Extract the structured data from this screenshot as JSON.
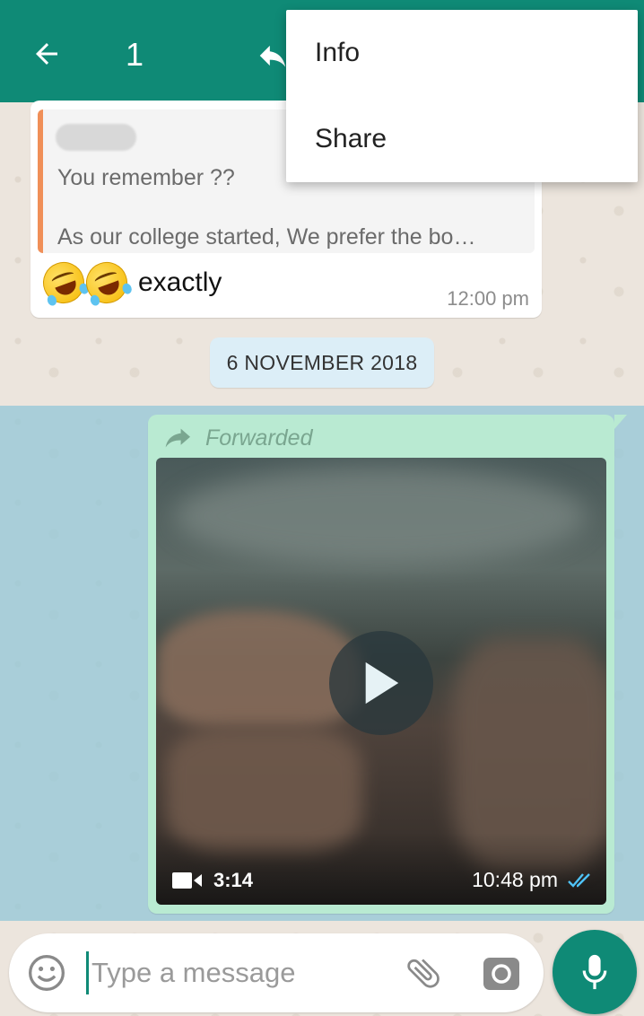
{
  "header": {
    "selected_count": "1",
    "back_icon": "arrow-left-icon",
    "reply_icon": "reply-icon"
  },
  "menu": {
    "items": [
      {
        "label": "Info"
      },
      {
        "label": "Share"
      }
    ]
  },
  "messages": {
    "incoming": {
      "quote": {
        "line1": "You remember ??",
        "line2": "As our college started, We prefer the bo…"
      },
      "emoji": "rolling-on-floor-laughing-emoji",
      "text": "exactly",
      "time": "12:00 pm"
    },
    "date_divider": "6 NOVEMBER 2018",
    "outgoing": {
      "forwarded_label": "Forwarded",
      "video_duration": "3:14",
      "time": "10:48 pm",
      "status": "read"
    }
  },
  "composer": {
    "placeholder": "Type a message"
  },
  "colors": {
    "primary": "#0f8a76",
    "outgoing_bubble": "#b9ead2",
    "quote_accent": "#f08f58",
    "read_ticks": "#4fc3f7"
  }
}
